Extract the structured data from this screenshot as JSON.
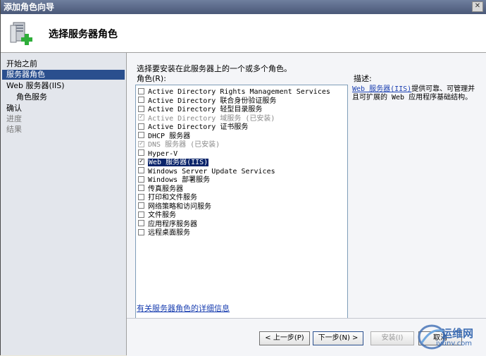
{
  "window": {
    "title": "添加角色向导",
    "close_glyph": "✕"
  },
  "header": {
    "title": "选择服务器角色",
    "icon": "server-role-add-icon"
  },
  "nav": {
    "items": [
      {
        "label": "开始之前",
        "state": "normal"
      },
      {
        "label": "服务器角色",
        "state": "active"
      },
      {
        "label": "Web 服务器(IIS)",
        "state": "normal"
      },
      {
        "label": "角色服务",
        "state": "sub"
      },
      {
        "label": "确认",
        "state": "normal"
      },
      {
        "label": "进度",
        "state": "disabled"
      },
      {
        "label": "结果",
        "state": "disabled"
      }
    ]
  },
  "content": {
    "instruction": "选择要安装在此服务器上的一个或多个角色。",
    "roles_label": "角色(R):",
    "roles": [
      {
        "label": "Active Directory Rights Management Services",
        "checked": false,
        "disabled": false,
        "selected": false
      },
      {
        "label": "Active Directory 联合身份验证服务",
        "checked": false,
        "disabled": false,
        "selected": false
      },
      {
        "label": "Active Directory 轻型目录服务",
        "checked": false,
        "disabled": false,
        "selected": false
      },
      {
        "label": "Active Directory 域服务  (已安装)",
        "checked": true,
        "disabled": true,
        "selected": false
      },
      {
        "label": "Active Directory 证书服务",
        "checked": false,
        "disabled": false,
        "selected": false
      },
      {
        "label": "DHCP 服务器",
        "checked": false,
        "disabled": false,
        "selected": false
      },
      {
        "label": "DNS 服务器  (已安装)",
        "checked": true,
        "disabled": true,
        "selected": false
      },
      {
        "label": "Hyper-V",
        "checked": false,
        "disabled": false,
        "selected": false
      },
      {
        "label": "Web 服务器(IIS)",
        "checked": true,
        "disabled": false,
        "selected": true
      },
      {
        "label": "Windows Server Update Services",
        "checked": false,
        "disabled": false,
        "selected": false
      },
      {
        "label": "Windows 部署服务",
        "checked": false,
        "disabled": false,
        "selected": false
      },
      {
        "label": "传真服务器",
        "checked": false,
        "disabled": false,
        "selected": false
      },
      {
        "label": "打印和文件服务",
        "checked": false,
        "disabled": false,
        "selected": false
      },
      {
        "label": "网络策略和访问服务",
        "checked": false,
        "disabled": false,
        "selected": false
      },
      {
        "label": "文件服务",
        "checked": false,
        "disabled": false,
        "selected": false
      },
      {
        "label": "应用程序服务器",
        "checked": false,
        "disabled": false,
        "selected": false
      },
      {
        "label": "远程桌面服务",
        "checked": false,
        "disabled": false,
        "selected": false
      }
    ],
    "description_label": "描述:",
    "description_link": "Web 服务器(IIS)",
    "description_text": "提供可靠、可管理并且可扩展的 Web 应用程序基础结构。",
    "more_info_link": "有关服务器角色的详细信息"
  },
  "buttons": {
    "prev": "< 上一步(P)",
    "next": "下一步(N) >",
    "install": "安装(I)",
    "cancel": "取消"
  },
  "watermark": {
    "line1": "运维网",
    "line2": "iyunv.com"
  },
  "colors": {
    "accent": "#2a4f8e",
    "link": "#1a3fb0",
    "selection": "#0a246a"
  }
}
